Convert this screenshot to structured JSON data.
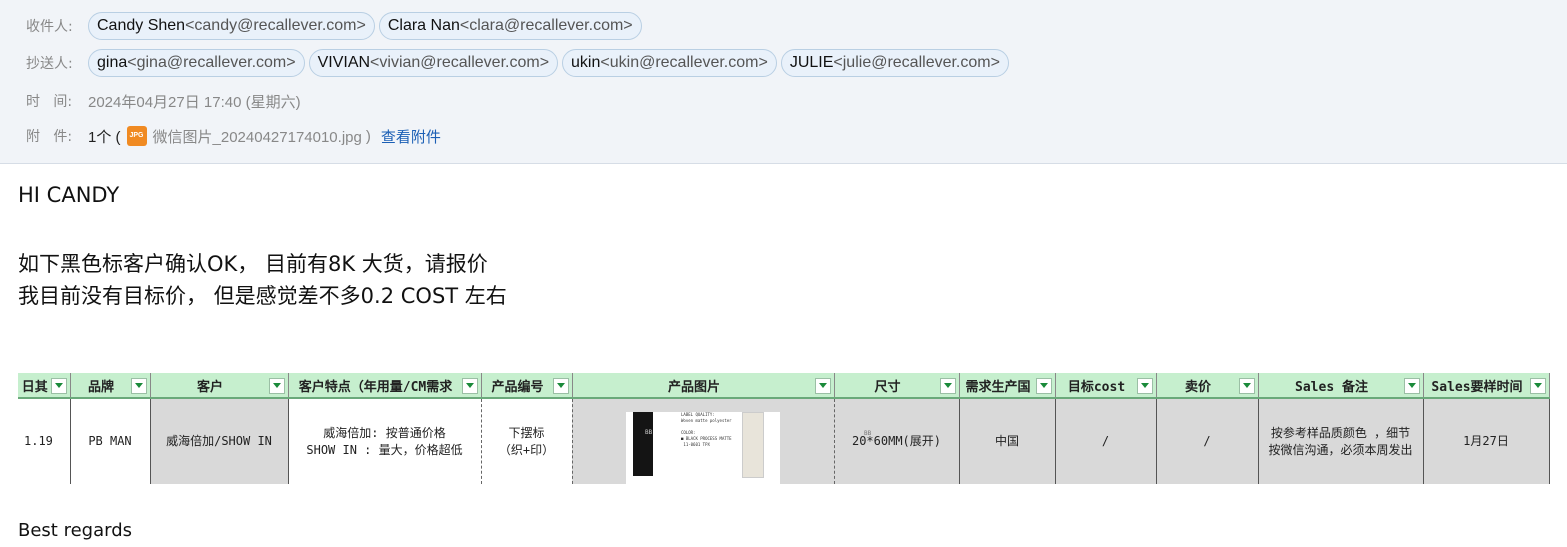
{
  "header": {
    "to_label": "收件人:",
    "to": [
      {
        "name": "Candy Shen",
        "email": "<candy@recallever.com>"
      },
      {
        "name": "Clara Nan",
        "email": "<clara@recallever.com>"
      }
    ],
    "cc_label": "抄送人:",
    "cc": [
      {
        "name": "gina",
        "email": "<gina@recallever.com>"
      },
      {
        "name": "VIVIAN",
        "email": "<vivian@recallever.com>"
      },
      {
        "name": "ukin",
        "email": "<ukin@recallever.com>"
      },
      {
        "name": "JULIE",
        "email": "<julie@recallever.com>"
      }
    ],
    "time_label": "时   间:",
    "time_value": "2024年04月27日 17:40 (星期六)",
    "attach_label": "附   件:",
    "attach_count": "1个 (",
    "attach_icon": "JPG",
    "attach_name": "微信图片_20240427174010.jpg",
    "attach_close": ")",
    "attach_link": "查看附件"
  },
  "body": {
    "greeting": "HI CANDY",
    "line1": "如下黑色标客户确认OK， 目前有8K 大货，请报价",
    "line2": "我目前没有目标价， 但是感觉差不多0.2 COST 左右",
    "closing": "Best regards"
  },
  "sheet": {
    "headers": [
      "日其",
      "品牌",
      "客户",
      "客户特点（年用量/CM需求",
      "产品编号",
      "产品图片",
      "尺寸",
      "需求生产国",
      "目标cost",
      "卖价",
      "Sales 备注",
      "Sales要样时间"
    ],
    "row": {
      "date": "1.19",
      "brand": "PB MAN",
      "customer": "威海倍加/SHOW IN",
      "features": "威海倍加:  按普通价格\nSHOW IN :  量大，价格超低",
      "product": "下摆标\n（织+印）",
      "size": "20*60MM(展开)",
      "country": "中国",
      "target_cost": "/",
      "price": "/",
      "remark": "按参考样品质颜色 ，细节\n按微信沟通，必须本周发出",
      "sample_time": "1月27日"
    },
    "thumb": {
      "info": "LABEL QUALITY:\nWoven matte polyester\n\nCOLOR:\n■ BLACK PROCESS MATTE\n 11-0601 TPX",
      "logo_left": "BB",
      "logo_right": "BB"
    }
  }
}
